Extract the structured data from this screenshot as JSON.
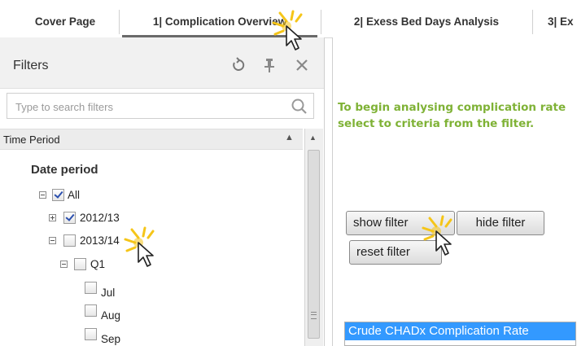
{
  "tabs": [
    {
      "label": "Cover Page",
      "active": false
    },
    {
      "label": "1| Complication Overview",
      "active": true
    },
    {
      "label": "2| Exess Bed Days Analysis",
      "active": false
    },
    {
      "label": "3| Ex",
      "active": false
    }
  ],
  "filters": {
    "title": "Filters",
    "icons": [
      "reset-icon",
      "pin-icon",
      "close-icon"
    ],
    "search_placeholder": "Type to search filters",
    "section_title": "Time Period",
    "group_title": "Date period",
    "tree": [
      {
        "label": "All",
        "checked": true,
        "expander": "minus"
      },
      {
        "label": "2012/13",
        "checked": true,
        "expander": "plus"
      },
      {
        "label": "2013/14",
        "checked": false,
        "expander": "minus"
      },
      {
        "label": "Q1",
        "checked": false,
        "expander": "minus"
      },
      {
        "label": "Jul",
        "checked": false,
        "expander": null
      },
      {
        "label": "Aug",
        "checked": false,
        "expander": null
      },
      {
        "label": "Sep",
        "checked": false,
        "expander": null
      }
    ]
  },
  "right_panel": {
    "instructions": "To begin analysing complication rate select  to criteria from the filter.",
    "show_filter_label": "show filter",
    "hide_filter_label": "hide filter",
    "reset_filter_label": "reset filter",
    "list_selected_item": "Crude CHADx Complication Rate"
  },
  "colors": {
    "instruction_text": "#7fb236",
    "selection_highlight": "#3399ff",
    "click_burst": "#f5c518"
  }
}
